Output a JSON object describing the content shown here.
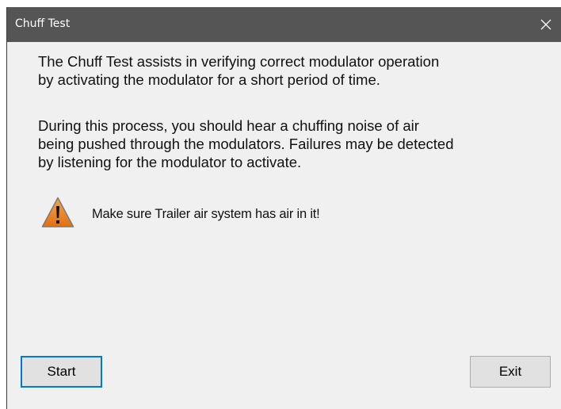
{
  "window": {
    "title": "Chuff Test",
    "close_icon": "close-icon"
  },
  "content": {
    "paragraph1": [
      "The Chuff Test assists in verifying correct modulator operation",
      "by activating the modulator for a short period of time."
    ],
    "paragraph2": [
      "During this process, you should hear a chuffing noise of air",
      "being pushed through the modulators. Failures may be detected",
      "by listening for the modulator to activate."
    ],
    "warning": {
      "icon": "warning-icon",
      "text": "Make sure Trailer air system has air in it!"
    }
  },
  "buttons": {
    "start_label": "Start",
    "exit_label": "Exit"
  },
  "colors": {
    "titlebar": "#555555",
    "dialog_background": "#f0f0f0",
    "focus_border": "#0078d7",
    "button_face": "#e1e1e1",
    "warning_orange": "#e8801e"
  }
}
